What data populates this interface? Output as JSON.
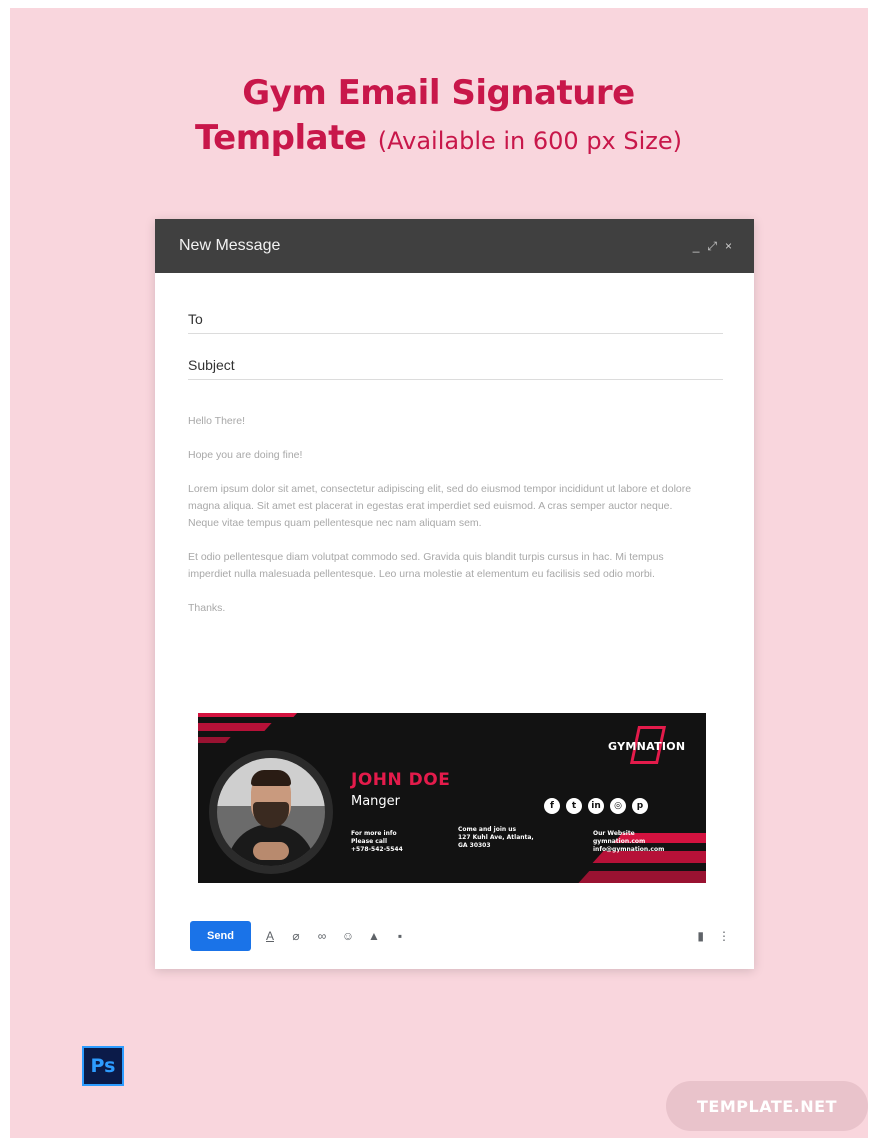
{
  "headline": {
    "line1": "Gym Email Signature",
    "line2_bold": "Template",
    "line2_sub": "(Available in 600 px Size)"
  },
  "compose": {
    "title": "New Message",
    "controls": {
      "minimize": "_",
      "expand": "⤢",
      "close": "×"
    },
    "to_label": "To",
    "subject_label": "Subject",
    "body": [
      "Hello There!",
      "Hope you are doing fine!",
      "Lorem ipsum dolor sit amet, consectetur adipiscing elit, sed do eiusmod tempor incididunt ut labore et dolore magna aliqua. Sit amet est placerat in egestas erat imperdiet sed euismod. A cras semper auctor neque. Neque vitae tempus quam pellentesque nec nam aliquam sem.",
      "Et odio pellentesque diam volutpat commodo sed. Gravida quis blandit turpis cursus in hac. Mi tempus imperdiet nulla malesuada pellentesque. Leo urna molestie at elementum eu facilisis sed odio morbi.",
      "Thanks."
    ]
  },
  "signature": {
    "name": "JOHN DOE",
    "role": "Manger",
    "brand": "GYMNATION",
    "contact_1": [
      "For more info",
      "Please call",
      "+578-542-5544"
    ],
    "contact_2": [
      "Come and join us",
      "127 Kuhl Ave, Atlanta,",
      "GA 30303"
    ],
    "contact_3": [
      "Our Website",
      "gymnation.com",
      "info@gymnation.com"
    ],
    "socials": [
      "facebook-icon",
      "twitter-icon",
      "linkedin-icon",
      "instagram-icon",
      "pinterest-icon"
    ],
    "social_glyphs": [
      "f",
      "t",
      "in",
      "◎",
      "p"
    ],
    "colors": {
      "accent": "#e31b4b",
      "background": "#121212"
    }
  },
  "toolbar": {
    "send_label": "Send",
    "icons": [
      "format-text-icon",
      "attach-icon",
      "link-icon",
      "emoji-icon",
      "drive-icon",
      "photo-icon"
    ],
    "icon_glyphs": [
      "A",
      "⌀",
      "∞",
      "☺",
      "▲",
      "▪"
    ],
    "right_icons": [
      "trash-icon",
      "more-options-icon"
    ],
    "right_glyphs": [
      "▮",
      "⋮"
    ]
  },
  "badges": {
    "ps": "Ps",
    "template_net": "TEMPLATE.NET"
  },
  "colors": {
    "poster_bg": "#f9d6dd",
    "headline": "#c8174a",
    "header_bg": "#404040",
    "send_button": "#1a73e8"
  }
}
